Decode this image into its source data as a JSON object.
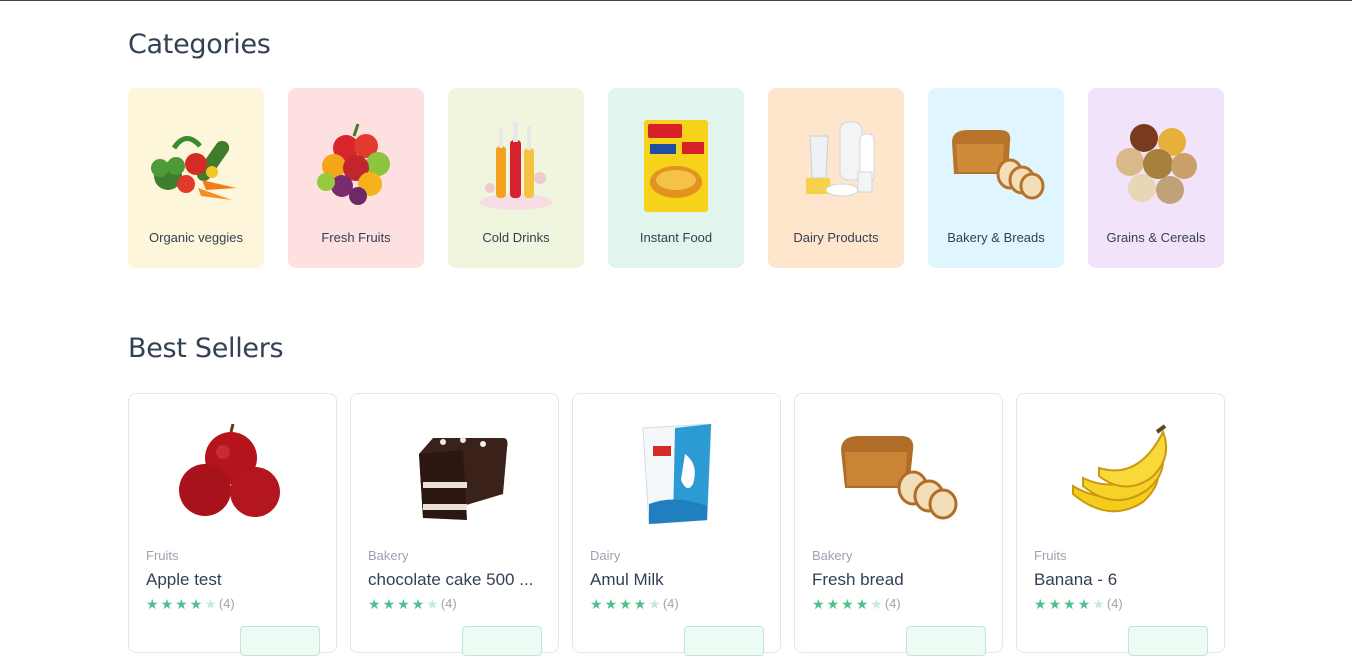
{
  "categories_section": {
    "title": "Categories",
    "items": [
      {
        "label": "Organic veggies",
        "bg": "#fef6da",
        "icon": "vegetables-icon"
      },
      {
        "label": "Fresh Fruits",
        "bg": "#fee0e0",
        "icon": "fruits-icon"
      },
      {
        "label": "Cold Drinks",
        "bg": "#f0f5de",
        "icon": "drinks-icon"
      },
      {
        "label": "Instant Food",
        "bg": "#e1f5ec",
        "icon": "instant-noodles-icon"
      },
      {
        "label": "Dairy Products",
        "bg": "#fee6cd",
        "icon": "dairy-icon"
      },
      {
        "label": "Bakery & Breads",
        "bg": "#e0f6fe",
        "icon": "bread-icon"
      },
      {
        "label": "Grains & Cereals",
        "bg": "#f1e3f9",
        "icon": "grains-icon"
      }
    ]
  },
  "best_sellers": {
    "title": "Best Sellers",
    "products": [
      {
        "category": "Fruits",
        "name": "Apple test",
        "rating": 4,
        "rating_count": "(4)",
        "icon": "apple-icon"
      },
      {
        "category": "Bakery",
        "name": "chocolate cake 500 ...",
        "rating": 4,
        "rating_count": "(4)",
        "icon": "cake-icon"
      },
      {
        "category": "Dairy",
        "name": "Amul Milk",
        "rating": 4,
        "rating_count": "(4)",
        "icon": "milk-pouch-icon"
      },
      {
        "category": "Bakery",
        "name": "Fresh bread",
        "rating": 4,
        "rating_count": "(4)",
        "icon": "bread-icon"
      },
      {
        "category": "Fruits",
        "name": "Banana - 6",
        "rating": 4,
        "rating_count": "(4)",
        "icon": "banana-icon"
      }
    ]
  },
  "colors": {
    "accent": "#4fbf8b",
    "text": "#334155",
    "muted": "#9ca3af"
  }
}
